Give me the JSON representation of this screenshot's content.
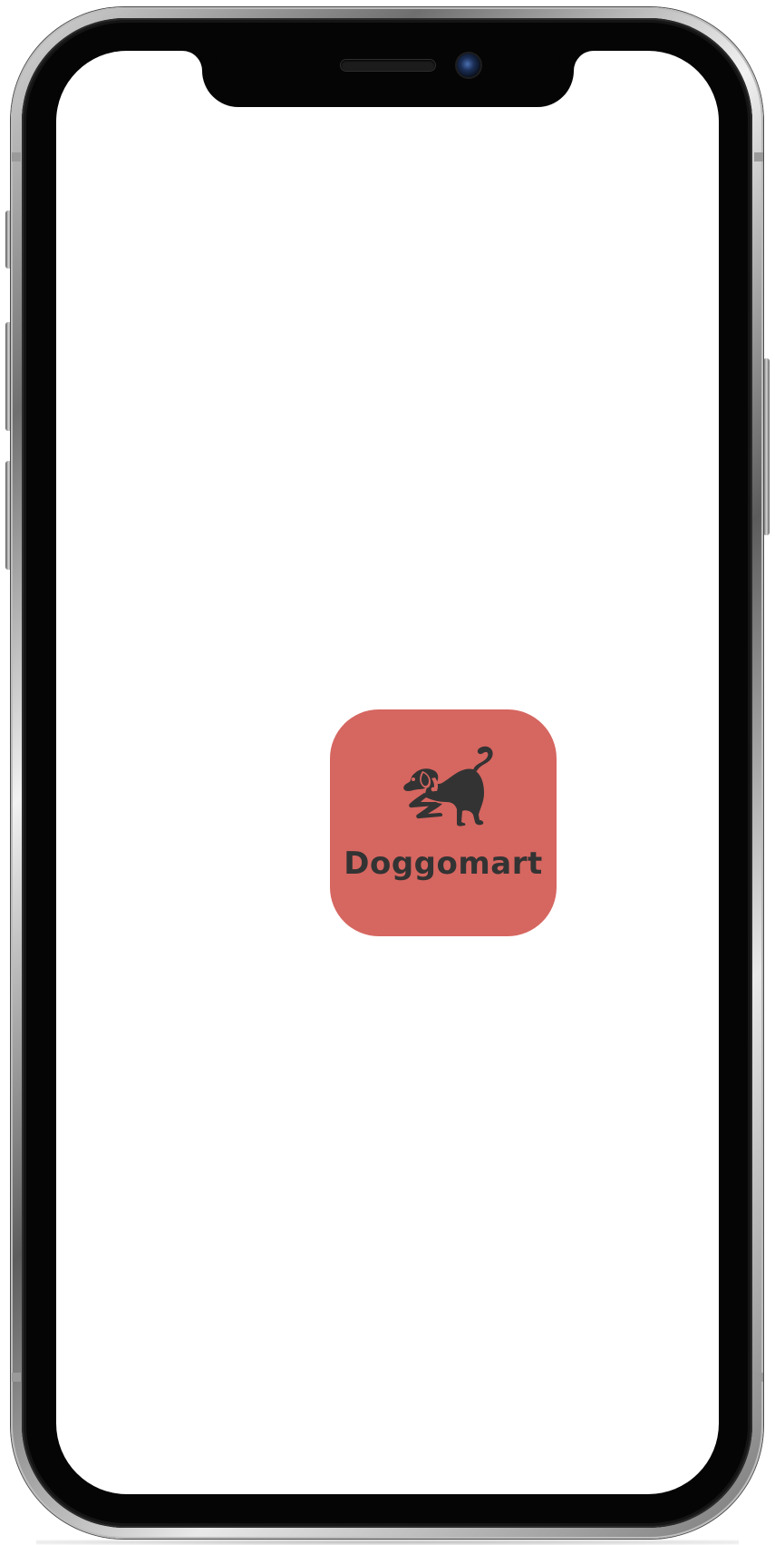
{
  "app": {
    "name": "Doggomart",
    "brand_color": "#d66660",
    "text_color": "#333333",
    "logo_icon": "dog-play-bow-icon"
  },
  "screen": {
    "background": "#ffffff"
  },
  "device": {
    "model": "iphone-x-style",
    "notch_icons": [
      "speaker-grille-icon",
      "front-camera-icon"
    ]
  }
}
